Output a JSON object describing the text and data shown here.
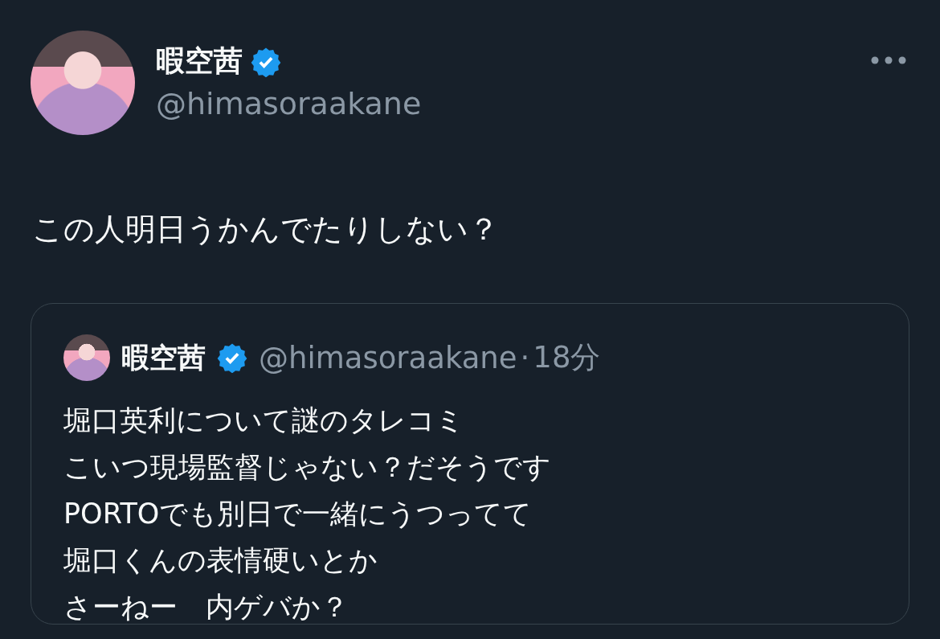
{
  "tweet": {
    "author": {
      "name": "暇空茜",
      "handle": "@himasoraakane",
      "verified": true
    },
    "text": "この人明日うかんでたりしない？",
    "quote": {
      "author": {
        "name": "暇空茜",
        "handle": "@himasoraakane",
        "verified": true
      },
      "separator": "·",
      "time": "18分",
      "lines": [
        "堀口英利について謎のタレコミ",
        "こいつ現場監督じゃない？だそうです",
        "PORTOでも別日で一緒にうつってて",
        "堀口くんの表情硬いとか",
        "さーねー　内ゲバか？"
      ]
    }
  }
}
